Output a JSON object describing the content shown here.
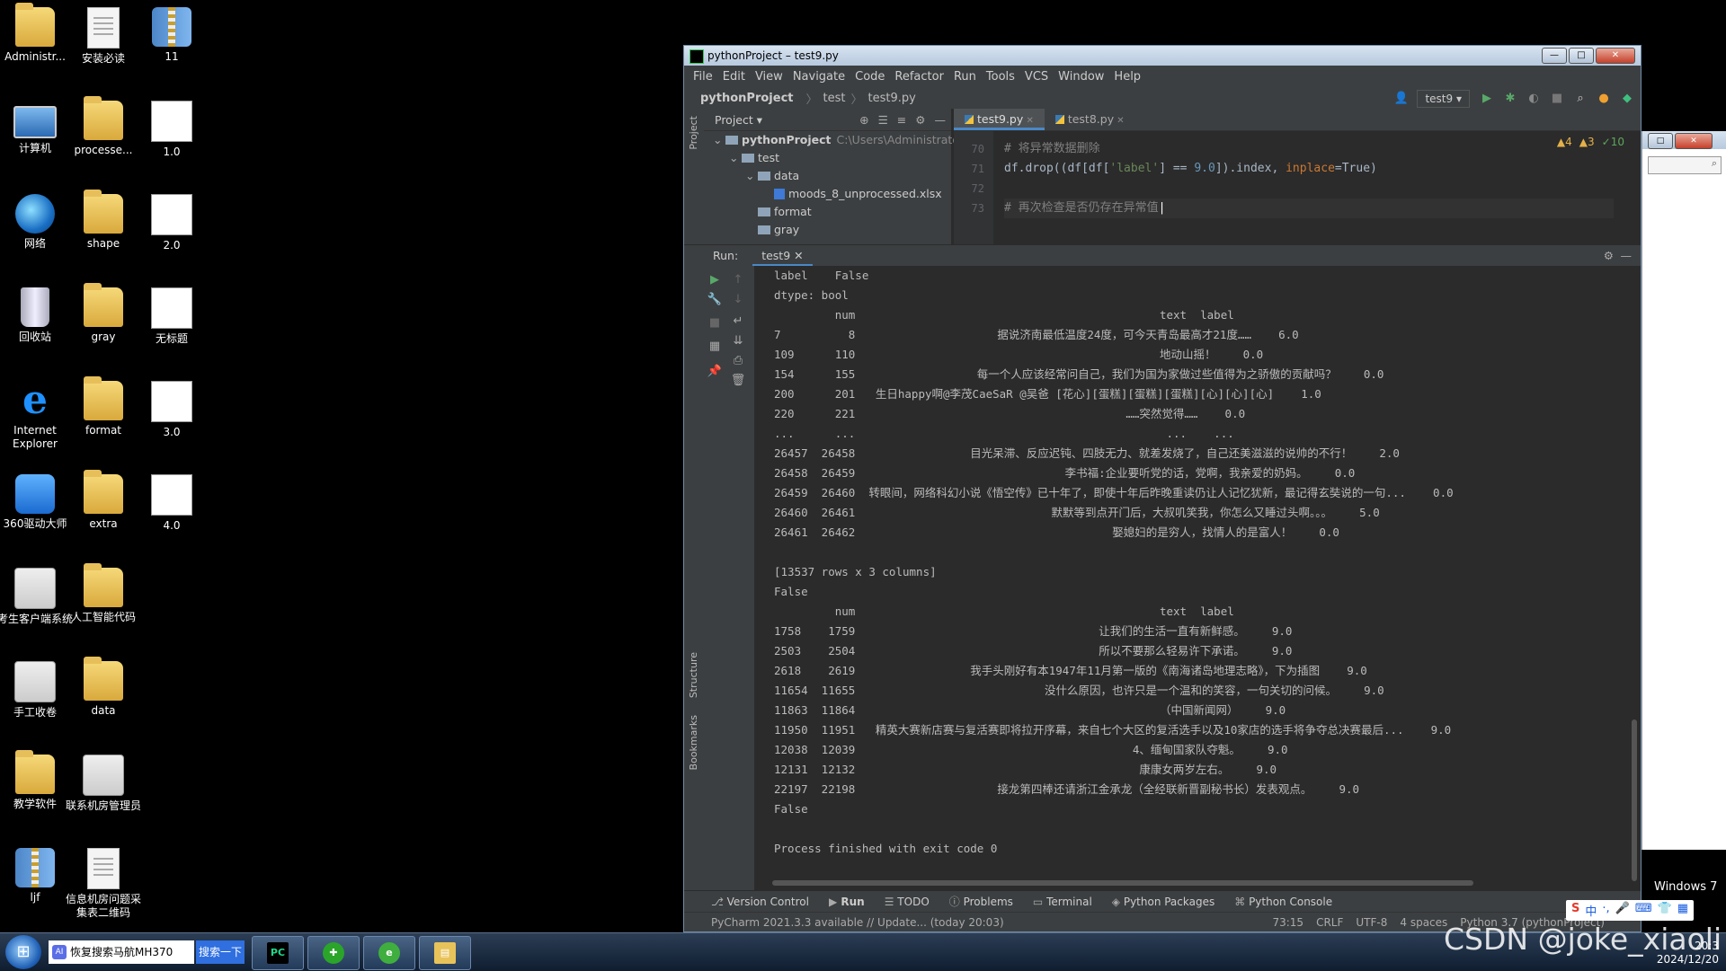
{
  "desktop_icons": [
    {
      "label": "Administr...",
      "kind": "folder",
      "col": 0,
      "row": 0
    },
    {
      "label": "安装必读",
      "kind": "doc",
      "col": 1,
      "row": 0
    },
    {
      "label": "11",
      "kind": "zip",
      "col": 2,
      "row": 0
    },
    {
      "label": "计算机",
      "kind": "pc",
      "col": 0,
      "row": 1
    },
    {
      "label": "processe...",
      "kind": "folder",
      "col": 1,
      "row": 1
    },
    {
      "label": "1.0",
      "kind": "img",
      "col": 2,
      "row": 1
    },
    {
      "label": "网络",
      "kind": "globe",
      "col": 0,
      "row": 2
    },
    {
      "label": "shape",
      "kind": "folder",
      "col": 1,
      "row": 2
    },
    {
      "label": "2.0",
      "kind": "img",
      "col": 2,
      "row": 2
    },
    {
      "label": "回收站",
      "kind": "bin",
      "col": 0,
      "row": 3
    },
    {
      "label": "gray",
      "kind": "folder",
      "col": 1,
      "row": 3
    },
    {
      "label": "无标题",
      "kind": "img",
      "col": 2,
      "row": 3
    },
    {
      "label": "Internet Explorer",
      "kind": "ie",
      "col": 0,
      "row": 4
    },
    {
      "label": "format",
      "kind": "folder",
      "col": 1,
      "row": 4
    },
    {
      "label": "3.0",
      "kind": "img",
      "col": 2,
      "row": 4
    },
    {
      "label": "360驱动大师",
      "kind": "drv",
      "col": 0,
      "row": 5
    },
    {
      "label": "extra",
      "kind": "folder",
      "col": 1,
      "row": 5
    },
    {
      "label": "4.0",
      "kind": "img",
      "col": 2,
      "row": 5
    },
    {
      "label": "考生客户端系统",
      "kind": "app",
      "col": 0,
      "row": 6
    },
    {
      "label": "人工智能代码",
      "kind": "folder",
      "col": 1,
      "row": 6
    },
    {
      "label": "手工收卷",
      "kind": "app",
      "col": 0,
      "row": 7
    },
    {
      "label": "data",
      "kind": "folder",
      "col": 1,
      "row": 7
    },
    {
      "label": "教学软件",
      "kind": "folder",
      "col": 0,
      "row": 8
    },
    {
      "label": "联系机房管理员",
      "kind": "app",
      "col": 1,
      "row": 8
    },
    {
      "label": "ljf",
      "kind": "zip",
      "col": 0,
      "row": 9
    },
    {
      "label": "信息机房问题采集表二维码",
      "kind": "doc",
      "col": 1,
      "row": 9
    }
  ],
  "window": {
    "title": "pythonProject – test9.py",
    "btn_min": "—",
    "btn_max": "□",
    "btn_close": "✕"
  },
  "menu": [
    "File",
    "Edit",
    "View",
    "Navigate",
    "Code",
    "Refactor",
    "Run",
    "Tools",
    "VCS",
    "Window",
    "Help"
  ],
  "nav": {
    "project": "pythonProject",
    "folder": "test",
    "file": "test9.py",
    "run_config": "test9"
  },
  "project_panel": {
    "header": "Project",
    "rows": [
      {
        "indent": 0,
        "arrow": "⌄",
        "type": "dir",
        "name": "pythonProject",
        "path": "C:\\Users\\Administrator\\PycharmP"
      },
      {
        "indent": 1,
        "arrow": "⌄",
        "type": "dir",
        "name": "test",
        "path": ""
      },
      {
        "indent": 2,
        "arrow": "⌄",
        "type": "dir",
        "name": "data",
        "path": ""
      },
      {
        "indent": 3,
        "arrow": "",
        "type": "xl",
        "name": "moods_8_unprocessed.xlsx",
        "path": ""
      },
      {
        "indent": 2,
        "arrow": "",
        "type": "dir",
        "name": "format",
        "path": ""
      },
      {
        "indent": 2,
        "arrow": "",
        "type": "dir",
        "name": "gray",
        "path": ""
      }
    ]
  },
  "editor": {
    "tabs": [
      "test9.py",
      "test8.py"
    ],
    "inspections": {
      "warn1": "▲4",
      "warn2": "▲3",
      "ok": "✓10"
    },
    "line_numbers": [
      "70",
      "71",
      "72",
      "73"
    ],
    "lines": {
      "l70": "# 将异常数据删除",
      "l71_a": "df.drop((df[df[",
      "l71_b": "'label'",
      "l71_c": "] == ",
      "l71_d": "9.0",
      "l71_e": "]).index, ",
      "l71_f": "inplace",
      "l71_g": "=True)",
      "l72": "",
      "l73": "# 再次检查是否仍存在异常值"
    }
  },
  "run": {
    "label": "Run:",
    "tab": "test9",
    "output": [
      "label    False",
      "dtype: bool",
      "         num                                             text  label",
      "7          8                     据说济南最低温度24度，可今天青岛最高才21度……    6.0",
      "109      110                                             地动山摇！    0.0",
      "154      155                  每一个人应该经常问自己，我们为国为家做过些值得为之骄傲的贡献吗？    0.0",
      "200      201   生日happy啊@李茂CaeSaR @吴爸 [花心][蛋糕][蛋糕][蛋糕][心][心][心]    1.0",
      "220      221                                        ……突然觉得……    0.0",
      "...      ...                                              ...    ...",
      "26457  26458                 目光呆滞、反应迟钝、四肢无力、就差发烧了，自己还美滋滋的说帅的不行！    2.0",
      "26458  26459                               李书福:企业要听党的话，党啊，我亲爱的奶妈。    0.0",
      "26459  26460  转眼间，网络科幻小说《悟空传》已十年了，即使十年后昨晚重读仍让人记忆犹新，最记得玄奘说的一句...    0.0",
      "26460  26461                             默默等到点开门后，大叔叽笑我，你怎么又睡过头啊。。。    5.0",
      "26461  26462                                      娶媳妇的是穷人，找情人的是富人！    0.0",
      "",
      "[13537 rows x 3 columns]",
      "False",
      "         num                                             text  label",
      "1758    1759                                    让我们的生活一直有新鲜感。    9.0",
      "2503    2504                                    所以不要那么轻易许下承诺。    9.0",
      "2618    2619                 我手头刚好有本1947年11月第一版的《南海诸岛地理志略》，下为插图    9.0",
      "11654  11655                            没什么原因，也许只是一个温和的笑容，一句关切的问候。    9.0",
      "11863  11864                                             （中国新闻网）    9.0",
      "11950  11951   精英大赛新店赛与复活赛即将拉开序幕，来自七个大区的复活选手以及10家店的选手将争夺总决赛最后...    9.0",
      "12038  12039                                         4、缅甸国家队夺魁。    9.0",
      "12131  12132                                          康康女两岁左右。    9.0",
      "22197  22198                     接龙第四棒还请浙江金承龙（全经联新晋副秘书长）发表观点。    9.0",
      "False",
      "",
      "Process finished with exit code 0"
    ]
  },
  "side_labels": {
    "project": "Project",
    "structure": "Structure",
    "bookmarks": "Bookmarks"
  },
  "bottom_tabs": [
    "Version Control",
    "Run",
    "TODO",
    "Problems",
    "Terminal",
    "Python Packages",
    "Python Console"
  ],
  "status": {
    "message": "PyCharm 2021.3.3 available // Update... (today 20:03)",
    "pos": "73:15",
    "eol": "CRLF",
    "enc": "UTF-8",
    "indent": "4 spaces",
    "interp": "Python 3.7 (pythonProject)"
  },
  "taskbar": {
    "search_text": "恢复搜索马航MH370",
    "search_btn": "搜索一下",
    "ai_badge": "AI",
    "apps": [
      {
        "name": "pycharm",
        "glyph": "PC"
      },
      {
        "name": "360-guard",
        "glyph": "✚"
      },
      {
        "name": "360-browser",
        "glyph": "e"
      },
      {
        "name": "explorer",
        "glyph": "▤"
      }
    ],
    "ime": {
      "s": "S",
      "lang": "中",
      "punct": "·,",
      "mic": "🎤",
      "kbd": "⌨",
      "shirt": "👕",
      "grid": "▦"
    }
  },
  "os_label": "Windows 7",
  "watermark": "CSDN @joke_xiaoli",
  "clock": {
    "time": "20:3",
    "date": "2024/12/20"
  },
  "colors": {
    "accent": "#4a88c7",
    "ide_bg": "#2b2b2b",
    "panel_bg": "#3c3f41"
  }
}
